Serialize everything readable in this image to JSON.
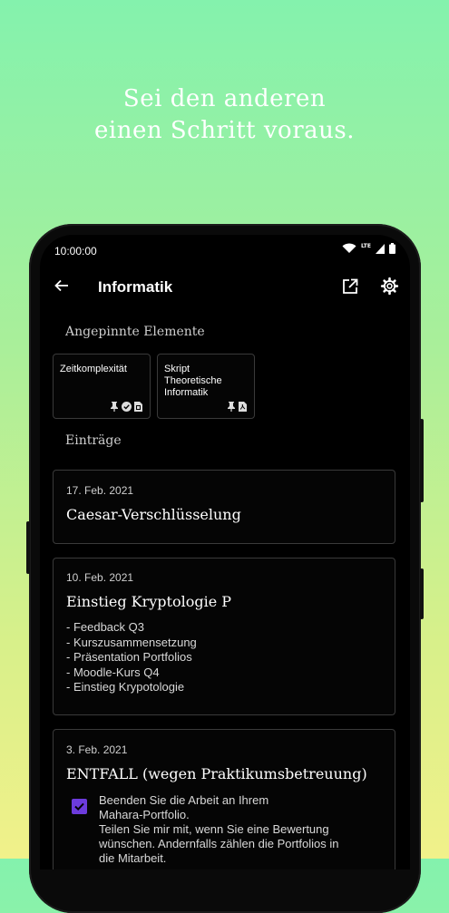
{
  "promo": {
    "line1": "Sei den anderen",
    "line2": "einen Schritt voraus."
  },
  "status_bar": {
    "time": "10:00:00",
    "network": "LTE"
  },
  "app_bar": {
    "title": "Informatik"
  },
  "pinned": {
    "heading": "Angepinnte Elemente",
    "items": [
      {
        "title": "Zeitkomplexität"
      },
      {
        "title": "Skript Theoretische Informatik"
      }
    ]
  },
  "entries": {
    "heading": "Einträge",
    "items": [
      {
        "date": "17. Feb. 2021",
        "title": "Caesar-Verschlüsselung"
      },
      {
        "date": "10. Feb. 2021",
        "title": "Einstieg Kryptologie P",
        "lines": [
          "- Feedback Q3",
          "- Kurszusammensetzung",
          "- Präsentation Portfolios",
          "- Moodle-Kurs Q4",
          "- Einstieg Krypotologie"
        ]
      },
      {
        "date": "3. Feb. 2021",
        "title": "ENTFALL (wegen Praktikumsbetreuung)",
        "task": {
          "checked": true,
          "lines": [
            "Beenden Sie die Arbeit an Ihrem",
            "Mahara-Portfolio.",
            "Teilen Sie mir mit, wenn Sie eine Bewertung",
            "wünschen. Andernfalls zählen die Portfolios in",
            "die Mitarbeit."
          ]
        }
      }
    ]
  },
  "colors": {
    "accent": "#6c3bdc",
    "background_top": "#84f2ad",
    "background_bottom": "#f1f18a"
  }
}
